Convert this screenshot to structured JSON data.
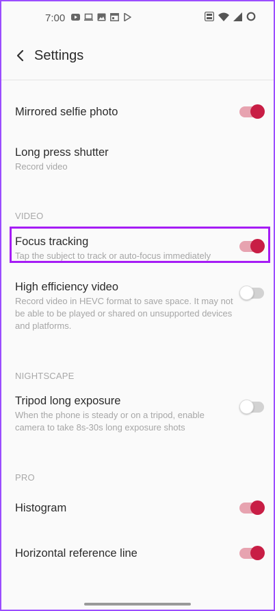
{
  "status_bar": {
    "time": "7:00",
    "left_icons": [
      "youtube-icon",
      "laptop-icon",
      "image-icon",
      "calendar-icon",
      "play-store-icon"
    ],
    "right_icons": [
      "volte-icon",
      "wifi-icon",
      "signal-icon",
      "battery-icon"
    ]
  },
  "header": {
    "title": "Settings",
    "back_icon": "chevron-left-icon"
  },
  "items": [
    {
      "id": "mirrored-selfie",
      "label": "Mirrored selfie photo",
      "subtitle": "",
      "toggle": true
    },
    {
      "id": "long-press-shutter",
      "label": "Long press shutter",
      "subtitle": "Record video",
      "toggle": null
    },
    {
      "id": "focus-tracking",
      "label": "Focus tracking",
      "subtitle": "Tap the subject to track or auto-focus immediately",
      "toggle": true
    },
    {
      "id": "hevc",
      "label": "High efficiency video",
      "subtitle": "Record video in HEVC format to save space. It may not be able to be played or shared on unsupported devices and platforms.",
      "toggle": false
    },
    {
      "id": "tripod",
      "label": "Tripod long exposure",
      "subtitle": "When the phone is steady or on a tripod, enable camera to take 8s-30s long exposure shots",
      "toggle": false
    },
    {
      "id": "histogram",
      "label": "Histogram",
      "subtitle": "",
      "toggle": true
    },
    {
      "id": "horizontal-line",
      "label": "Horizontal reference line",
      "subtitle": "",
      "toggle": true
    }
  ],
  "sections": {
    "video": "VIDEO",
    "nightscape": "NIGHTSCAPE",
    "pro": "PRO"
  },
  "colors": {
    "accent": "#c81e45",
    "accent_track": "#e7a3b0",
    "highlight": "#a51cf5"
  }
}
